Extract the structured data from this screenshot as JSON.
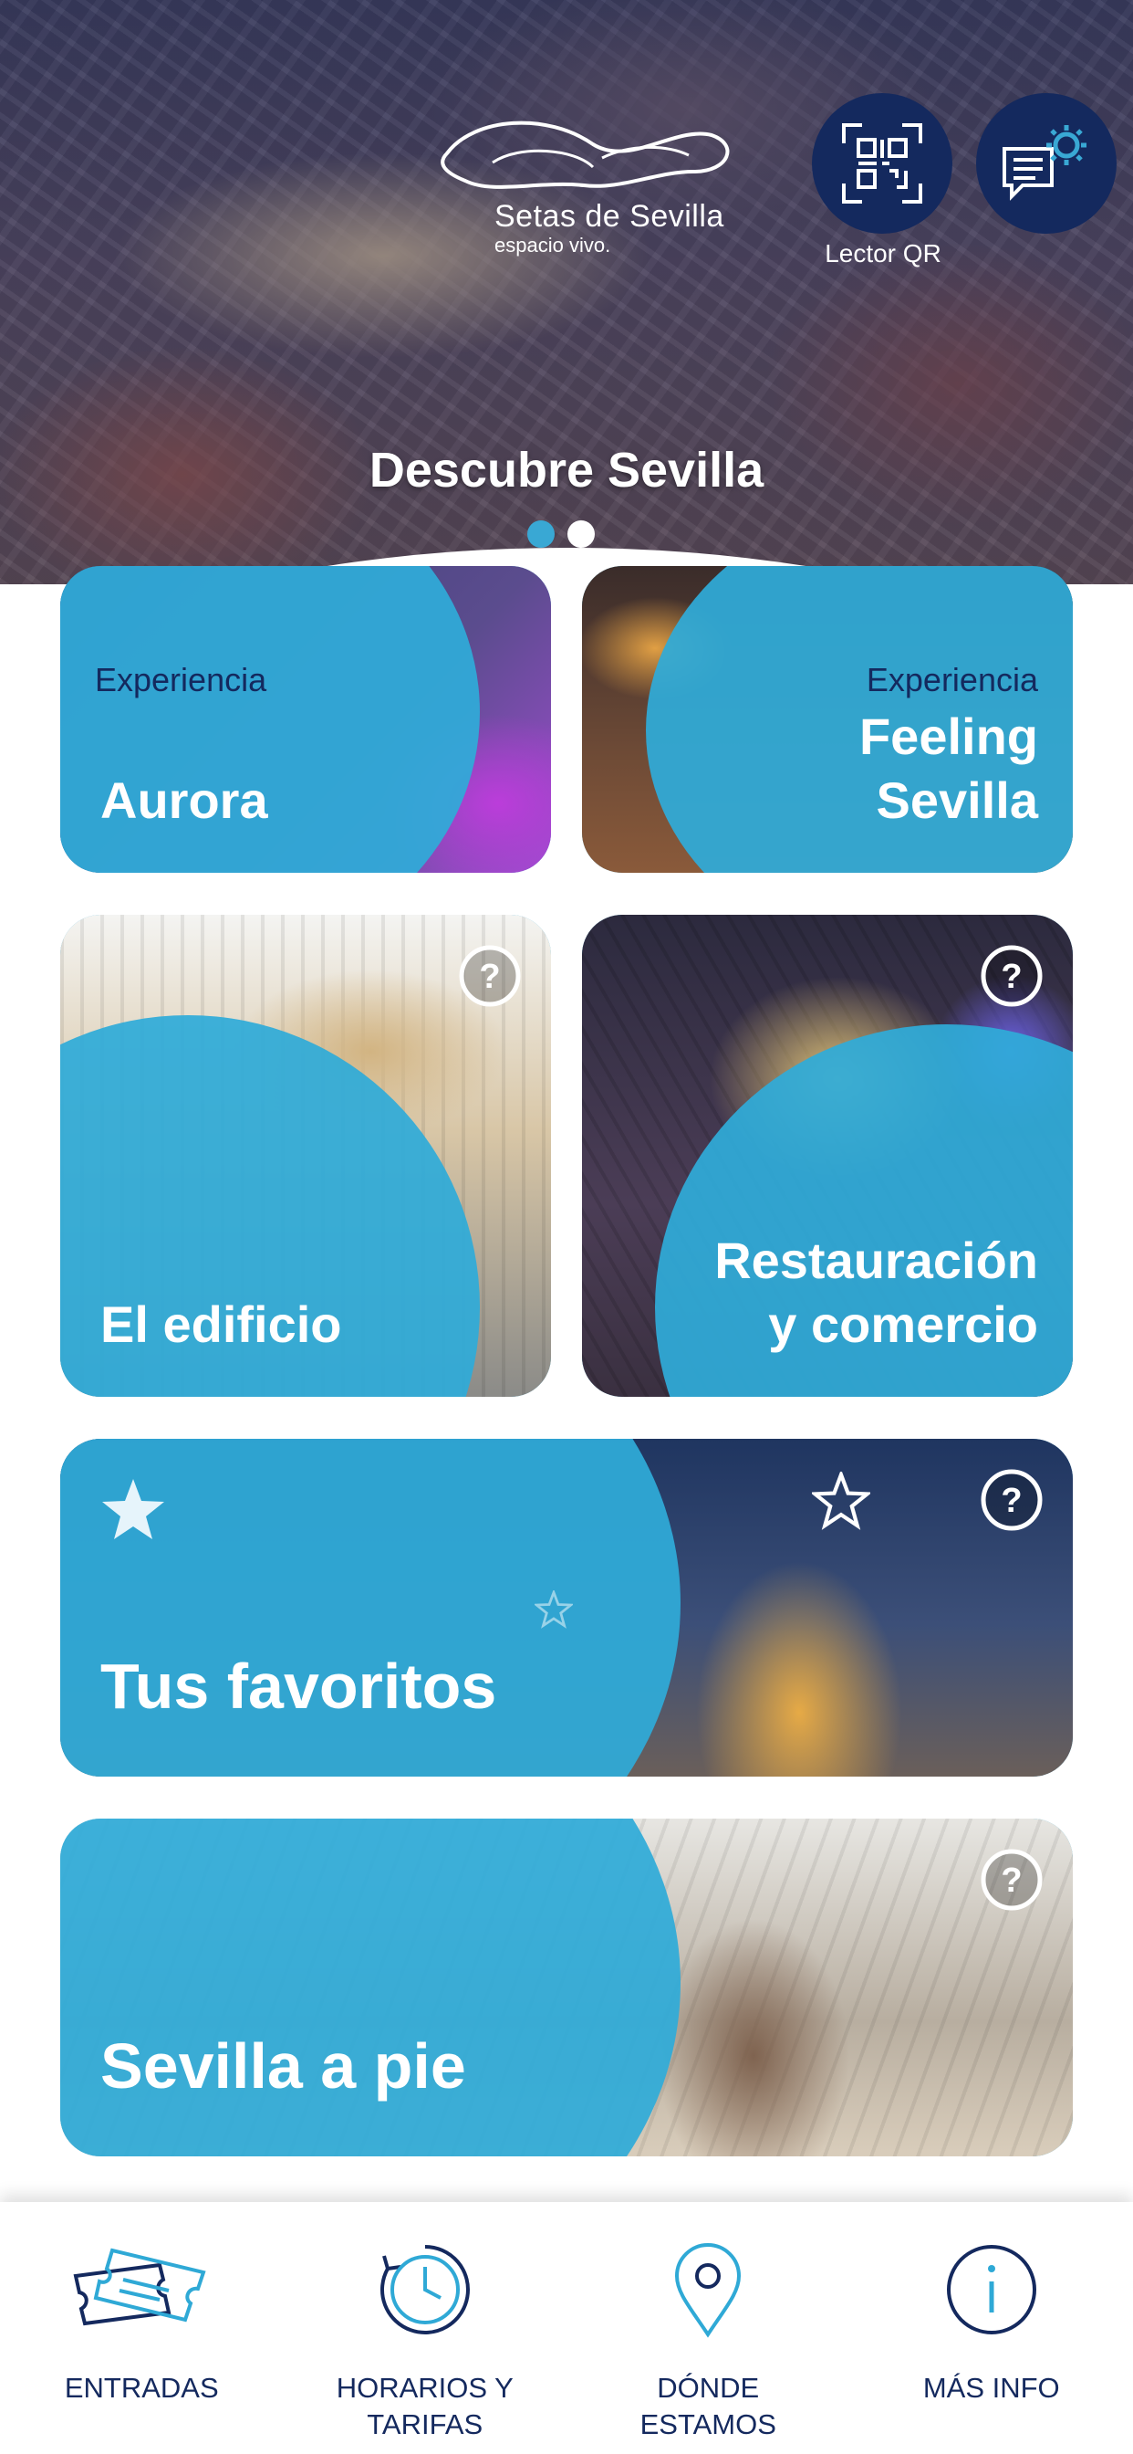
{
  "header": {
    "logo_title": "Setas de Sevilla",
    "logo_subtitle": "espacio vivo.",
    "qr_label": "Lector QR",
    "qr_icon": "qr-code-icon",
    "settings_icon": "chat-gear-icon"
  },
  "carousel": {
    "title": "Descubre Sevilla",
    "active_dot": 1,
    "dot_count": 2
  },
  "cards": {
    "aurora": {
      "kicker": "Experiencia",
      "title": "Aurora"
    },
    "feeling": {
      "kicker": "Experiencia",
      "title_line1": "Feeling",
      "title_line2": "Sevilla"
    },
    "edificio": {
      "title": "El edificio"
    },
    "restauracion": {
      "title_line1": "Restauración",
      "title_line2": "y comercio"
    },
    "favoritos": {
      "title": "Tus favoritos"
    },
    "pie": {
      "title": "Sevilla a pie"
    }
  },
  "bottom_nav": {
    "items": [
      {
        "label": "ENTRADAS",
        "icon": "ticket-icon"
      },
      {
        "label": "HORARIOS Y\nTARIFAS",
        "icon": "clock-icon"
      },
      {
        "label": "DÓNDE\nESTAMOS",
        "icon": "location-pin-icon"
      },
      {
        "label": "MÁS INFO",
        "icon": "info-icon"
      }
    ]
  },
  "colors": {
    "brand_blue": "#2fa9d6",
    "navy": "#14295e",
    "white": "#ffffff"
  }
}
